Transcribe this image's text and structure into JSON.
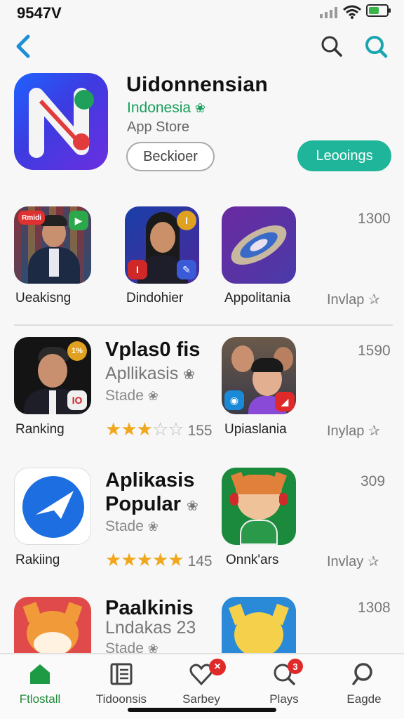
{
  "status": {
    "time": "9547V",
    "battery_percent": 60
  },
  "nav": {
    "back_icon": "chevron-left-icon",
    "search_icon": "search-icon"
  },
  "hero": {
    "title": "Uidonnensian",
    "subtitle": "Indonesia",
    "store": "App Store",
    "button_secondary": "Beckioer",
    "button_primary": "Leooings",
    "accent": "#1fb59a"
  },
  "row1": {
    "items": [
      {
        "label": "Ueakisng",
        "thumb_badge": "Rmidi"
      },
      {
        "label": "Dindohier",
        "thumb_badge": "I"
      },
      {
        "label": "Appolitania"
      }
    ],
    "count": "1300",
    "side": "Invlap"
  },
  "row2": {
    "icon_label": "Ranking",
    "icon_badge_top": "1%",
    "icon_badge_bottom": "IO",
    "title": "Vplas0 fis",
    "subtitle": "Apllikasis",
    "meta": "Stade",
    "rating": 3,
    "rating_count": "155",
    "right_label": "Upiaslania",
    "count": "1590",
    "side": "Inylap"
  },
  "row3": {
    "icon_label": "Rakiing",
    "title_line1": "Aplikasis",
    "title_line2": "Popular",
    "meta": "Stade",
    "rating": 5,
    "rating_count": "145",
    "right_label": "Onnk'ars",
    "count": "309",
    "side": "Invlay"
  },
  "row4": {
    "title": "Paalkinis",
    "subtitle": "Lndakas 23",
    "meta": "Stade",
    "count": "1308"
  },
  "tabs": [
    {
      "label": "Ftlostall",
      "icon": "home-icon",
      "active": true
    },
    {
      "label": "Tidoonsis",
      "icon": "list-icon",
      "active": false
    },
    {
      "label": "Sarbey",
      "icon": "heart-icon",
      "active": false,
      "badge": "×"
    },
    {
      "label": "Plays",
      "icon": "search-icon",
      "active": false,
      "badge": "3"
    },
    {
      "label": "Eagde",
      "icon": "search-icon",
      "active": false
    }
  ]
}
